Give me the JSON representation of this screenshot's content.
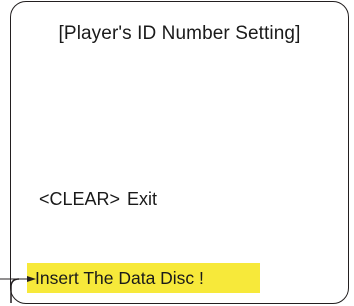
{
  "screen": {
    "title": "[Player's ID Number Setting]",
    "clear_key": "<CLEAR>",
    "clear_action": "Exit",
    "message": "Insert The Data Disc !"
  },
  "colors": {
    "message_highlight": "#f7e93a",
    "border": "#231f20",
    "text": "#1a1a1a"
  },
  "icons": {
    "callout": "callout-arrow-icon"
  }
}
